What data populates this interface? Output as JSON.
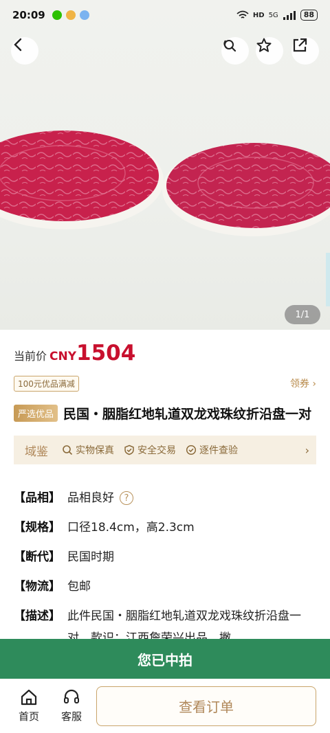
{
  "status": {
    "time": "20:09",
    "network": "5G",
    "hd": "HD",
    "battery": "88"
  },
  "nav": {
    "back_icon": "back-arrow-icon",
    "share_icon": "share-icon",
    "favorite_icon": "star-icon",
    "external_icon": "external-link-icon"
  },
  "gallery": {
    "counter": "1/1"
  },
  "price": {
    "label": "当前价",
    "currency": "CNY",
    "value": "1504"
  },
  "coupon": {
    "tag": "100元优品满减",
    "link": "领券 ›"
  },
  "title": {
    "tag": "严选优品",
    "text": "民国・胭脂红地轧道双龙戏珠纹折沿盘一对"
  },
  "guarantee": {
    "brand": "域鉴",
    "items": [
      "实物保真",
      "安全交易",
      "逐件查验"
    ]
  },
  "specs": [
    {
      "key": "【品相】",
      "value": "品相良好"
    },
    {
      "key": "【规格】",
      "value": "口径18.4cm，高2.3cm"
    },
    {
      "key": "【断代】",
      "value": "民国时期"
    },
    {
      "key": "【物流】",
      "value": "包邮"
    },
    {
      "key": "【描述】",
      "value": "此件民国・胭脂红地轧道双龙戏珠纹折沿盘一对，款识：江西詹荣兴出品，撇"
    }
  ],
  "won_banner": "您已中拍",
  "bottom": {
    "home": "首页",
    "service": "客服",
    "order_button": "查看订单"
  },
  "colors": {
    "price_red": "#c8102e",
    "gold": "#b0885a",
    "won_green": "#2e8b5b",
    "plate_red": "#c4234f"
  }
}
